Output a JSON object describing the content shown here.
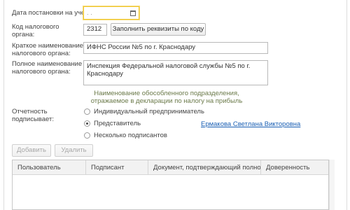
{
  "form": {
    "registration_date_label": "Дата постановки на учет:",
    "registration_date_value": " .  .",
    "tax_code_label_line1": "Код налогового",
    "tax_code_label_line2": "органа:",
    "tax_code_value": "2312",
    "fill_button": "Заполнить реквизиты по коду",
    "short_name_label_line1": "Краткое наименование",
    "short_name_label_line2": "налогового органа:",
    "short_name_value": "ИФНС России №5 по г. Краснодару",
    "full_name_label_line1": "Полное наименование",
    "full_name_label_line2": "налогового органа:",
    "full_name_line1": "Инспекция Федеральной налоговой службы №5 по г.",
    "full_name_line2": "Краснодару",
    "hint_line1": "Наименование обособленного подразделения,",
    "hint_line2": "отражаемое в декларации по налогу на прибыль"
  },
  "signers": {
    "label_line1": "Отчетность",
    "label_line2": "подписывает:",
    "options": [
      {
        "label": "Индивидуальный предприниматель",
        "checked": false
      },
      {
        "label": "Представитель",
        "checked": true
      },
      {
        "label": "Несколько подписантов",
        "checked": false
      }
    ],
    "representative_link": "Ермакова Светлана Викторовна"
  },
  "toolbar": {
    "add_label": "Добавить",
    "delete_label": "Удалить"
  },
  "table": {
    "columns": [
      "Пользователь",
      "Подписант",
      "Документ, подтверждающий полном...",
      "Доверенность"
    ]
  },
  "colors": {
    "focus_border": "#f0c62d",
    "link": "#1a5fb4",
    "hint": "#6b7a4a"
  }
}
